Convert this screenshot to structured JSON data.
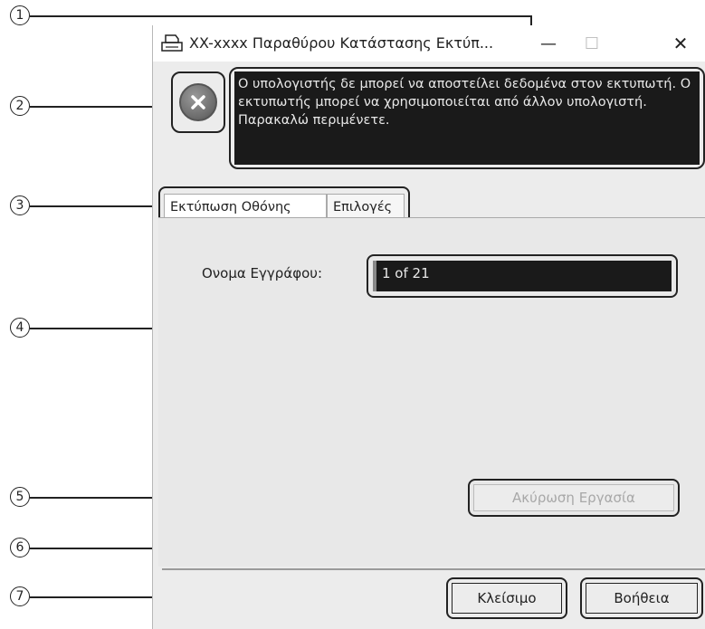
{
  "window": {
    "title": "XX-xxxx Παραθύρου Κατάστασης Εκτύπ...",
    "min_symbol": "—",
    "max_symbol": "☐",
    "close_symbol": "✕"
  },
  "status": {
    "icon": "error-x-icon",
    "message": "Ο υπολογιστής δε μπορεί να αποστείλει δεδομένα στον εκτυπωτή. Ο εκτυπωτής μπορεί να χρησιμοποιείται από άλλον υπολογιστή. Παρακαλώ περιμένετε."
  },
  "tabs": [
    {
      "label": "Εκτύπωση Οθόνης"
    },
    {
      "label": "Επιλογές"
    }
  ],
  "document": {
    "label": "Ονομα Εγγράφου:",
    "value": "1 of 21"
  },
  "cancel_job": {
    "label": "Ακύρωση Εργασία"
  },
  "buttons": {
    "close": "Κλείσιμο",
    "help": "Βοήθεια"
  },
  "callouts": [
    "1",
    "2",
    "3",
    "4",
    "5",
    "6",
    "7"
  ]
}
